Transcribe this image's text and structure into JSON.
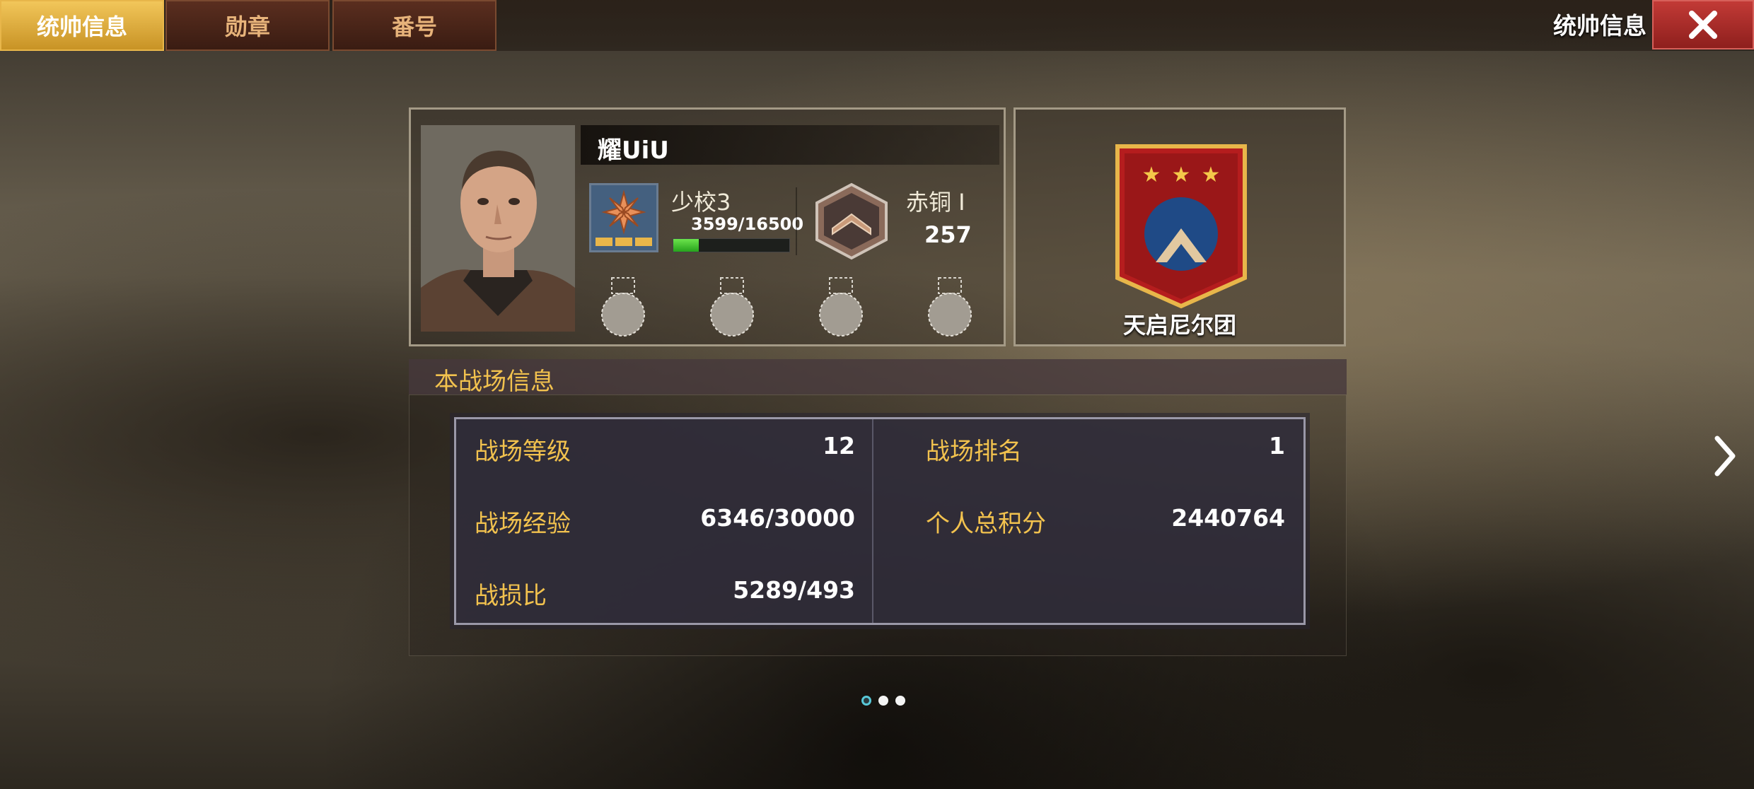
{
  "tabs": [
    {
      "label": "统帅信息",
      "active": true
    },
    {
      "label": "勋章",
      "active": false
    },
    {
      "label": "番号",
      "active": false
    }
  ],
  "header": {
    "title": "统帅信息",
    "close_icon": "close-x-icon"
  },
  "profile": {
    "name": "耀UiU",
    "rank": "少校3",
    "exp_text": "3599/16500",
    "exp_progress": 0.218,
    "league": "赤铜 I",
    "league_score": "257",
    "medal_slots": 4
  },
  "legion": {
    "name": "天启尼尔团",
    "stars": 3,
    "banner_color": "#b51d1e"
  },
  "battlefield": {
    "title": "本战场信息",
    "stats": [
      {
        "label": "战场等级",
        "value": "12"
      },
      {
        "label": "战场排名",
        "value": "1"
      },
      {
        "label": "战场经验",
        "value": "6346/30000"
      },
      {
        "label": "个人总积分",
        "value": "2440764"
      },
      {
        "label": "战损比",
        "value": "5289/493"
      }
    ]
  },
  "pager": {
    "total": 3,
    "active_index": 0
  },
  "colors": {
    "accent_gold": "#f2c24e",
    "tab_active": "#e8b64a",
    "close_red": "#b42e2b"
  }
}
